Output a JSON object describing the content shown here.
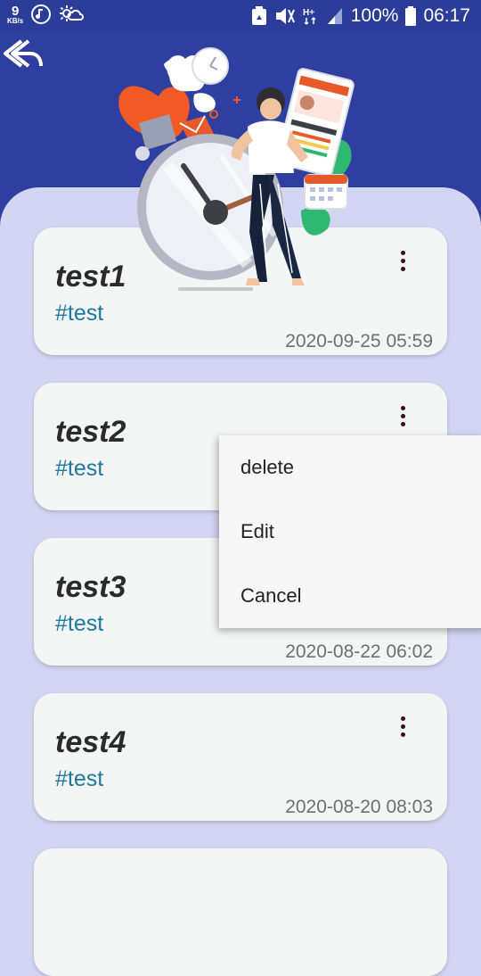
{
  "status_bar": {
    "net_speed": "9",
    "net_unit": "KB/s",
    "battery": "100%",
    "time": "06:17",
    "icons": [
      "music-note-icon",
      "weather-icon",
      "recycle-icon",
      "mute-icon",
      "hplus-icon",
      "signal-icon",
      "battery-icon"
    ]
  },
  "header": {
    "back_icon": "double-back-arrow-icon",
    "illustration": "clock-person-illustration"
  },
  "notes": [
    {
      "title": "test1",
      "tag": "#test",
      "date": "2020-09-25 05:59"
    },
    {
      "title": "test2",
      "tag": "#test",
      "date": ""
    },
    {
      "title": "test3",
      "tag": "#test",
      "date": "2020-08-22 06:02"
    },
    {
      "title": "test4",
      "tag": "#test",
      "date": "2020-08-20 08:03"
    }
  ],
  "context_menu": {
    "items": [
      "delete",
      "Edit",
      "Cancel"
    ]
  },
  "colors": {
    "header": "#2f3f9f",
    "background": "#d3d6f2",
    "card": "#f4f5f5",
    "tag": "#1f78a0",
    "accent": "#f15a24"
  }
}
